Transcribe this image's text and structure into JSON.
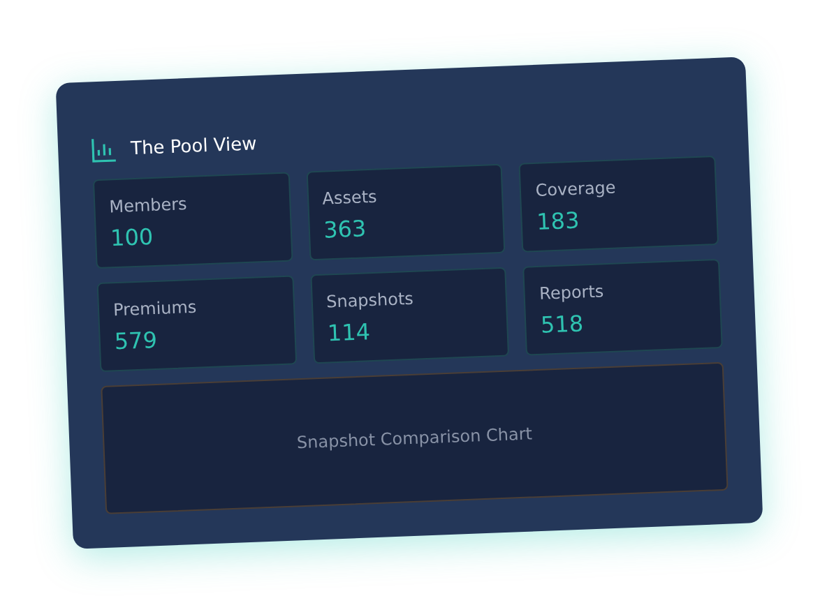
{
  "panel": {
    "title": "The Pool View"
  },
  "stats": [
    {
      "label": "Members",
      "value": "100"
    },
    {
      "label": "Assets",
      "value": "363"
    },
    {
      "label": "Coverage",
      "value": "183"
    },
    {
      "label": "Premiums",
      "value": "579"
    },
    {
      "label": "Snapshots",
      "value": "114"
    },
    {
      "label": "Reports",
      "value": "518"
    }
  ],
  "chart_placeholder": "Snapshot Comparison Chart"
}
